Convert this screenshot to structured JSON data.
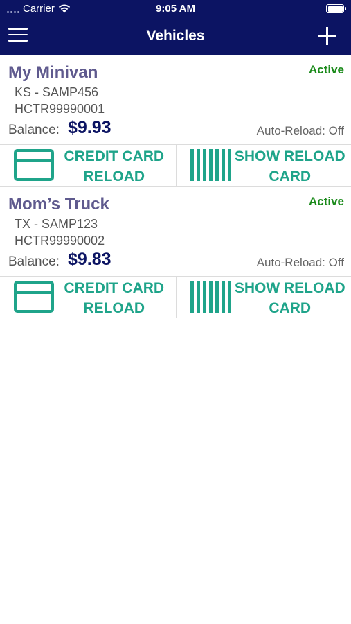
{
  "status_bar": {
    "carrier": "Carrier",
    "time": "9:05 AM"
  },
  "nav": {
    "title": "Vehicles",
    "menu_icon": "hamburger-menu-icon",
    "add_icon": "plus-icon"
  },
  "vehicles": [
    {
      "name": "My Minivan",
      "status": "Active",
      "plate": "KS - SAMP456",
      "account": "HCTR99990001",
      "balance_label": "Balance:",
      "balance": "$9.93",
      "auto_reload": "Auto-Reload: Off",
      "credit_line1": "CREDIT CARD",
      "credit_line2": "RELOAD",
      "reload_line1": "SHOW RELOAD",
      "reload_line2": "CARD"
    },
    {
      "name": "Mom’s Truck",
      "status": "Active",
      "plate": "TX - SAMP123",
      "account": "HCTR99990002",
      "balance_label": "Balance:",
      "balance": "$9.83",
      "auto_reload": "Auto-Reload: Off",
      "credit_line1": "CREDIT CARD",
      "credit_line2": "RELOAD",
      "reload_line1": "SHOW RELOAD",
      "reload_line2": "CARD"
    }
  ],
  "colors": {
    "header": "#0c1463",
    "accent": "#1fa48a",
    "active": "#1a8a1a",
    "vehicle_name": "#5f5a8e",
    "balance": "#0c1463"
  }
}
